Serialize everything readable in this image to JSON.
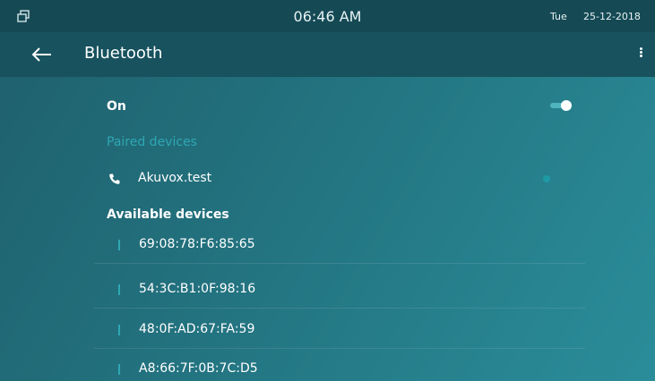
{
  "status_bar": {
    "time": "06:46 AM",
    "day": "Tue",
    "date": "25-12-2018",
    "icons": [
      "window-icon"
    ]
  },
  "title_bar": {
    "title": "Bluetooth",
    "icons": [
      "back-arrow-icon",
      "more-vert-icon"
    ]
  },
  "bluetooth": {
    "on_label": "On",
    "enabled": true
  },
  "paired": {
    "header": "Paired devices",
    "devices": [
      {
        "name": "Akuvox.test",
        "icon": "phone-icon",
        "connected": true
      }
    ]
  },
  "available": {
    "header": "Available devices",
    "devices": [
      {
        "address": "69:08:78:F6:85:65",
        "icon": "bluetooth-icon"
      },
      {
        "address": "54:3C:B1:0F:98:16",
        "icon": "bluetooth-icon"
      },
      {
        "address": "48:0F:AD:67:FA:59",
        "icon": "bluetooth-icon"
      },
      {
        "address": "A8:66:7F:0B:7C:D5",
        "icon": "bluetooth-icon"
      }
    ]
  },
  "colors": {
    "status_bar_bg": "#154a55",
    "title_bar_bg": "#17525e",
    "accent": "#2ea7b3",
    "toggle_track": "#4fb4be"
  }
}
